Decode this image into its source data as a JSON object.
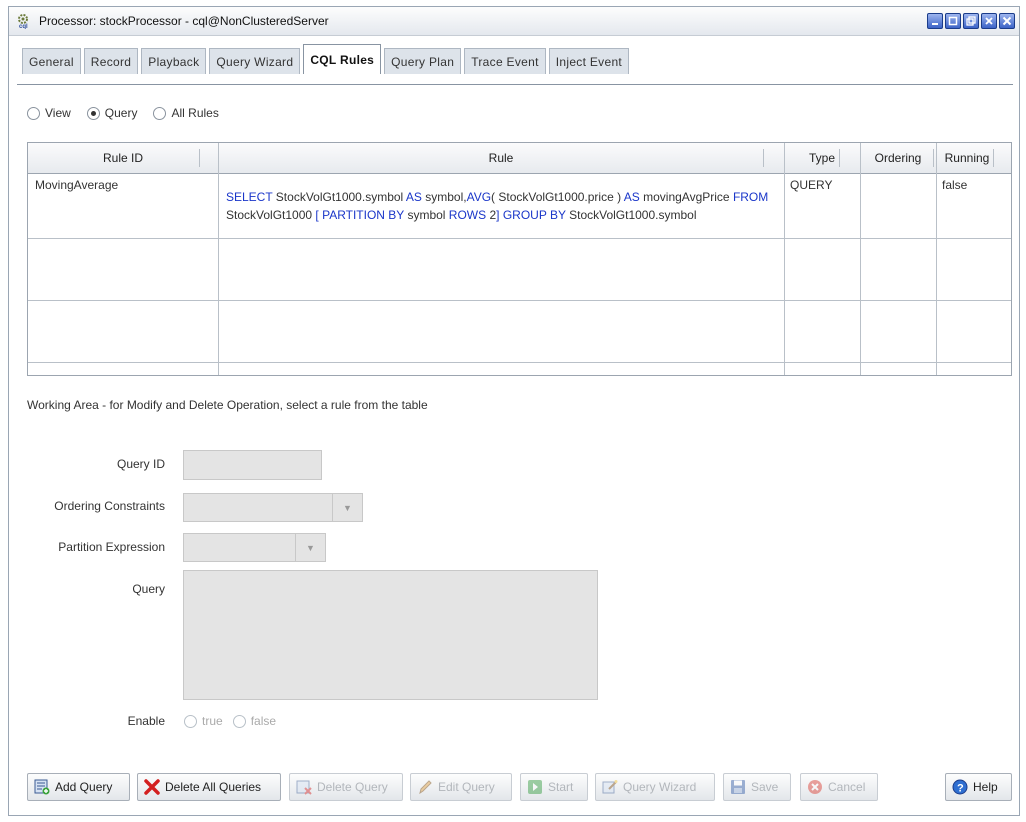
{
  "window": {
    "title": "Processor: stockProcessor - cql@NonClusteredServer",
    "title_icon": "cql-gear-icon",
    "controls": [
      "minimize",
      "maximize",
      "restore",
      "close-tab",
      "close"
    ]
  },
  "tabs": [
    "General",
    "Record",
    "Playback",
    "Query Wizard",
    "CQL Rules",
    "Query Plan",
    "Trace Event",
    "Inject Event"
  ],
  "active_tab": "CQL Rules",
  "filter": {
    "options": [
      "View",
      "Query",
      "All Rules"
    ],
    "selected": "Query"
  },
  "table": {
    "headers": [
      "Rule ID",
      "Rule",
      "Type",
      "Ordering",
      "Running"
    ],
    "rows": [
      {
        "rule_id": "MovingAverage",
        "rule_line1": "SELECT StockVolGt1000.symbol AS symbol,AVG( StockVolGt1000.price ) AS movingAvgPrice FROM",
        "rule_line2": "StockVolGt1000 [ PARTITION BY symbol ROWS 2] GROUP BY StockVolGt1000.symbol",
        "type": "QUERY",
        "ordering": "",
        "running": "false"
      }
    ]
  },
  "working_area": {
    "label": "Working Area - for Modify and Delete Operation, select a rule from the table",
    "query_id_label": "Query ID",
    "ordering_label": "Ordering Constraints",
    "partition_label": "Partition Expression",
    "query_label": "Query",
    "enable_label": "Enable",
    "enable_options": [
      "true",
      "false"
    ]
  },
  "buttons": {
    "add_query": "Add Query",
    "delete_all": "Delete All Queries",
    "delete_query": "Delete Query",
    "edit_query": "Edit Query",
    "start": "Start",
    "query_wizard": "Query Wizard",
    "save": "Save",
    "cancel": "Cancel",
    "help": "Help"
  },
  "colors": {
    "keyword": "#1a36c9",
    "window_button": "#3c63c7",
    "disabled_text": "#b2b6bb"
  }
}
